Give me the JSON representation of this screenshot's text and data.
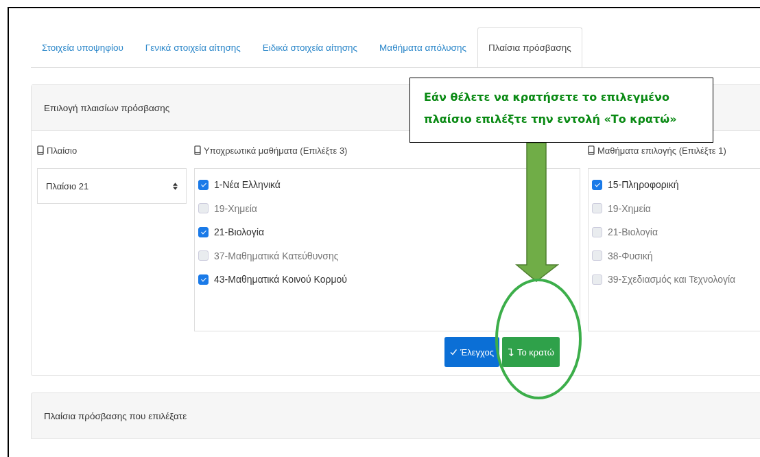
{
  "tabs": [
    {
      "label": "Στοιχεία υποψηφίου",
      "selected": false
    },
    {
      "label": "Γενικά στοιχεία αίτησης",
      "selected": false
    },
    {
      "label": "Ειδικά στοιχεία αίτησης",
      "selected": false
    },
    {
      "label": "Μαθήματα απόλυσης",
      "selected": false
    },
    {
      "label": "Πλαίσια πρόσβασης",
      "selected": true
    }
  ],
  "selection_card": {
    "title": "Επιλογή πλαισίων πρόσβασης",
    "frame": {
      "label": "Πλαίσιο",
      "value": "Πλαίσιο 21"
    },
    "required_courses": {
      "label": "Υποχρεωτικά μαθήματα (Επιλέξτε 3)",
      "items": [
        {
          "label": "1-Νέα Ελληνικά",
          "checked": true
        },
        {
          "label": "19-Χημεία",
          "checked": false
        },
        {
          "label": "21-Βιολογία",
          "checked": true
        },
        {
          "label": "37-Μαθηματικά Κατεύθυνσης",
          "checked": false
        },
        {
          "label": "43-Μαθηματικά Κοινού Κορμού",
          "checked": true
        }
      ]
    },
    "elective_courses": {
      "label": "Μαθήματα επιλογής (Επιλέξτε 1)",
      "items": [
        {
          "label": "15-Πληροφορική",
          "checked": true
        },
        {
          "label": "19-Χημεία",
          "checked": false
        },
        {
          "label": "21-Βιολογία",
          "checked": false
        },
        {
          "label": "38-Φυσική",
          "checked": false
        },
        {
          "label": "39-Σχεδιασμός και Τεχνολογία",
          "checked": false
        }
      ]
    },
    "buttons": [
      {
        "kind": "check",
        "label": "Έλεγχος"
      },
      {
        "kind": "keep",
        "label": "Το κρατώ"
      }
    ]
  },
  "chosen_card": {
    "title": "Πλαίσια πρόσβασης που επιλέξατε"
  },
  "callout": {
    "text": "Εάν θέλετε να κρατήσετε το επιλεγμένο πλαίσιο επιλέξτε την εντολή «Το κρατώ»"
  }
}
